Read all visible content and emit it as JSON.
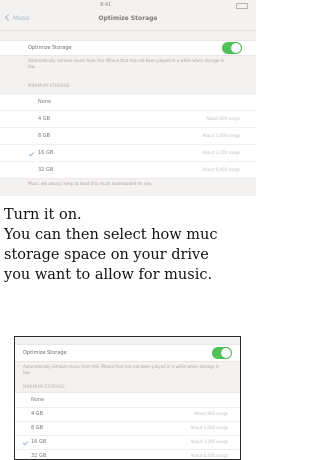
{
  "screen": {
    "status_time": "9:41",
    "nav": {
      "back_label": "Music",
      "title": "Optimize Storage"
    },
    "toggle_label": "Optimize Storage",
    "toggle_on": true,
    "toggle_description": "Automatically remove music from this iPhone that has not been played in a while when storage is low.",
    "section_header": "MINIMUM STORAGE",
    "options": [
      {
        "label": "None",
        "detail": "",
        "selected": false
      },
      {
        "label": "4 GB",
        "detail": "About 800 songs",
        "selected": false
      },
      {
        "label": "8 GB",
        "detail": "About 1,600 songs",
        "selected": false
      },
      {
        "label": "16 GB",
        "detail": "About 3,200 songs",
        "selected": true
      },
      {
        "label": "32 GB",
        "detail": "About 6,400 songs",
        "selected": false
      }
    ],
    "footer_description": "Music will always keep at least this much downloaded for you."
  },
  "caption": {
    "line1": "Turn it on.",
    "line2": "You can then select how muc",
    "line3": "storage space on your drive",
    "line4": "you want to allow for music."
  },
  "colors": {
    "toggle_on": "#4fc35a",
    "ios_blue": "#9fb8d6",
    "background": "#f4f2f1"
  }
}
